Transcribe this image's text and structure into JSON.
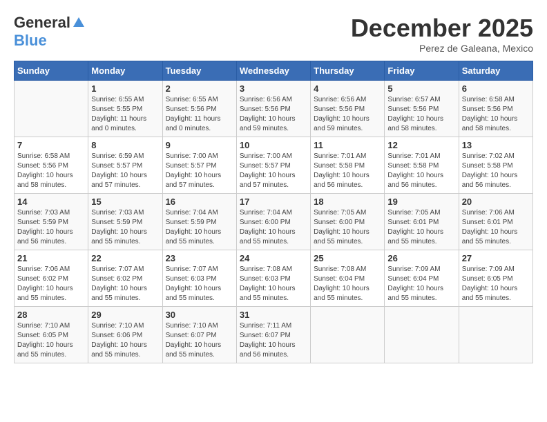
{
  "header": {
    "logo_general": "General",
    "logo_blue": "Blue",
    "month": "December 2025",
    "location": "Perez de Galeana, Mexico"
  },
  "days_of_week": [
    "Sunday",
    "Monday",
    "Tuesday",
    "Wednesday",
    "Thursday",
    "Friday",
    "Saturday"
  ],
  "weeks": [
    [
      {
        "day": "",
        "info": ""
      },
      {
        "day": "1",
        "info": "Sunrise: 6:55 AM\nSunset: 5:55 PM\nDaylight: 11 hours\nand 0 minutes."
      },
      {
        "day": "2",
        "info": "Sunrise: 6:55 AM\nSunset: 5:56 PM\nDaylight: 11 hours\nand 0 minutes."
      },
      {
        "day": "3",
        "info": "Sunrise: 6:56 AM\nSunset: 5:56 PM\nDaylight: 10 hours\nand 59 minutes."
      },
      {
        "day": "4",
        "info": "Sunrise: 6:56 AM\nSunset: 5:56 PM\nDaylight: 10 hours\nand 59 minutes."
      },
      {
        "day": "5",
        "info": "Sunrise: 6:57 AM\nSunset: 5:56 PM\nDaylight: 10 hours\nand 58 minutes."
      },
      {
        "day": "6",
        "info": "Sunrise: 6:58 AM\nSunset: 5:56 PM\nDaylight: 10 hours\nand 58 minutes."
      }
    ],
    [
      {
        "day": "7",
        "info": "Sunrise: 6:58 AM\nSunset: 5:56 PM\nDaylight: 10 hours\nand 58 minutes."
      },
      {
        "day": "8",
        "info": "Sunrise: 6:59 AM\nSunset: 5:57 PM\nDaylight: 10 hours\nand 57 minutes."
      },
      {
        "day": "9",
        "info": "Sunrise: 7:00 AM\nSunset: 5:57 PM\nDaylight: 10 hours\nand 57 minutes."
      },
      {
        "day": "10",
        "info": "Sunrise: 7:00 AM\nSunset: 5:57 PM\nDaylight: 10 hours\nand 57 minutes."
      },
      {
        "day": "11",
        "info": "Sunrise: 7:01 AM\nSunset: 5:58 PM\nDaylight: 10 hours\nand 56 minutes."
      },
      {
        "day": "12",
        "info": "Sunrise: 7:01 AM\nSunset: 5:58 PM\nDaylight: 10 hours\nand 56 minutes."
      },
      {
        "day": "13",
        "info": "Sunrise: 7:02 AM\nSunset: 5:58 PM\nDaylight: 10 hours\nand 56 minutes."
      }
    ],
    [
      {
        "day": "14",
        "info": "Sunrise: 7:03 AM\nSunset: 5:59 PM\nDaylight: 10 hours\nand 56 minutes."
      },
      {
        "day": "15",
        "info": "Sunrise: 7:03 AM\nSunset: 5:59 PM\nDaylight: 10 hours\nand 55 minutes."
      },
      {
        "day": "16",
        "info": "Sunrise: 7:04 AM\nSunset: 5:59 PM\nDaylight: 10 hours\nand 55 minutes."
      },
      {
        "day": "17",
        "info": "Sunrise: 7:04 AM\nSunset: 6:00 PM\nDaylight: 10 hours\nand 55 minutes."
      },
      {
        "day": "18",
        "info": "Sunrise: 7:05 AM\nSunset: 6:00 PM\nDaylight: 10 hours\nand 55 minutes."
      },
      {
        "day": "19",
        "info": "Sunrise: 7:05 AM\nSunset: 6:01 PM\nDaylight: 10 hours\nand 55 minutes."
      },
      {
        "day": "20",
        "info": "Sunrise: 7:06 AM\nSunset: 6:01 PM\nDaylight: 10 hours\nand 55 minutes."
      }
    ],
    [
      {
        "day": "21",
        "info": "Sunrise: 7:06 AM\nSunset: 6:02 PM\nDaylight: 10 hours\nand 55 minutes."
      },
      {
        "day": "22",
        "info": "Sunrise: 7:07 AM\nSunset: 6:02 PM\nDaylight: 10 hours\nand 55 minutes."
      },
      {
        "day": "23",
        "info": "Sunrise: 7:07 AM\nSunset: 6:03 PM\nDaylight: 10 hours\nand 55 minutes."
      },
      {
        "day": "24",
        "info": "Sunrise: 7:08 AM\nSunset: 6:03 PM\nDaylight: 10 hours\nand 55 minutes."
      },
      {
        "day": "25",
        "info": "Sunrise: 7:08 AM\nSunset: 6:04 PM\nDaylight: 10 hours\nand 55 minutes."
      },
      {
        "day": "26",
        "info": "Sunrise: 7:09 AM\nSunset: 6:04 PM\nDaylight: 10 hours\nand 55 minutes."
      },
      {
        "day": "27",
        "info": "Sunrise: 7:09 AM\nSunset: 6:05 PM\nDaylight: 10 hours\nand 55 minutes."
      }
    ],
    [
      {
        "day": "28",
        "info": "Sunrise: 7:10 AM\nSunset: 6:05 PM\nDaylight: 10 hours\nand 55 minutes."
      },
      {
        "day": "29",
        "info": "Sunrise: 7:10 AM\nSunset: 6:06 PM\nDaylight: 10 hours\nand 55 minutes."
      },
      {
        "day": "30",
        "info": "Sunrise: 7:10 AM\nSunset: 6:07 PM\nDaylight: 10 hours\nand 55 minutes."
      },
      {
        "day": "31",
        "info": "Sunrise: 7:11 AM\nSunset: 6:07 PM\nDaylight: 10 hours\nand 56 minutes."
      },
      {
        "day": "",
        "info": ""
      },
      {
        "day": "",
        "info": ""
      },
      {
        "day": "",
        "info": ""
      }
    ]
  ]
}
